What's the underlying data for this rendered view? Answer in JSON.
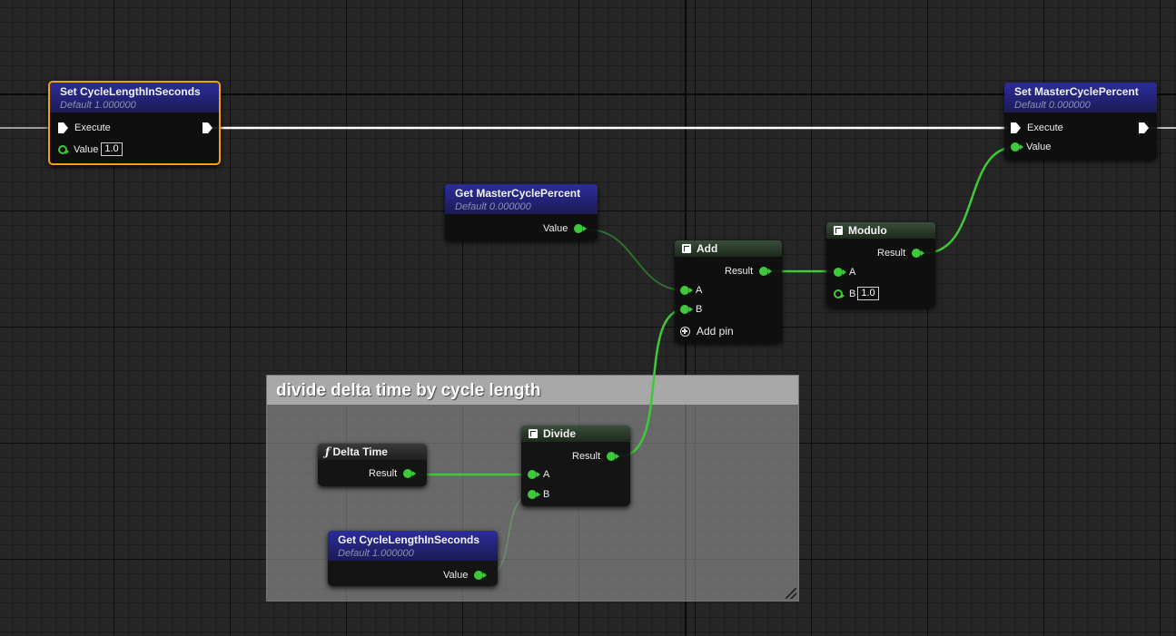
{
  "comment": {
    "title": "divide delta time by cycle length"
  },
  "nodes": {
    "set_cycle": {
      "title": "Set CycleLengthInSeconds",
      "subtitle": "Default 1.000000",
      "exec_label": "Execute",
      "value_label": "Value",
      "value": "1.0"
    },
    "set_master": {
      "title": "Set MasterCyclePercent",
      "subtitle": "Default 0.000000",
      "exec_label": "Execute",
      "value_label": "Value"
    },
    "get_master": {
      "title": "Get MasterCyclePercent",
      "subtitle": "Default 0.000000",
      "value_label": "Value"
    },
    "add": {
      "title": "Add",
      "result_label": "Result",
      "a_label": "A",
      "b_label": "B",
      "add_pin_label": "Add pin"
    },
    "modulo": {
      "title": "Modulo",
      "result_label": "Result",
      "a_label": "A",
      "b_label": "B",
      "b_value": "1.0"
    },
    "delta_time": {
      "glyph": "ƒ",
      "title": "Delta Time",
      "result_label": "Result"
    },
    "divide": {
      "title": "Divide",
      "result_label": "Result",
      "a_label": "A",
      "b_label": "B"
    },
    "get_cycle": {
      "title": "Get CycleLengthInSeconds",
      "subtitle": "Default 1.000000",
      "value_label": "Value"
    }
  },
  "colors": {
    "float_pin": "#3ec93a",
    "exec_wire": "#ffffff",
    "selection": "#f5a00f",
    "var_header": "#2c2c9c",
    "fn_header": "#3a4d3a"
  }
}
